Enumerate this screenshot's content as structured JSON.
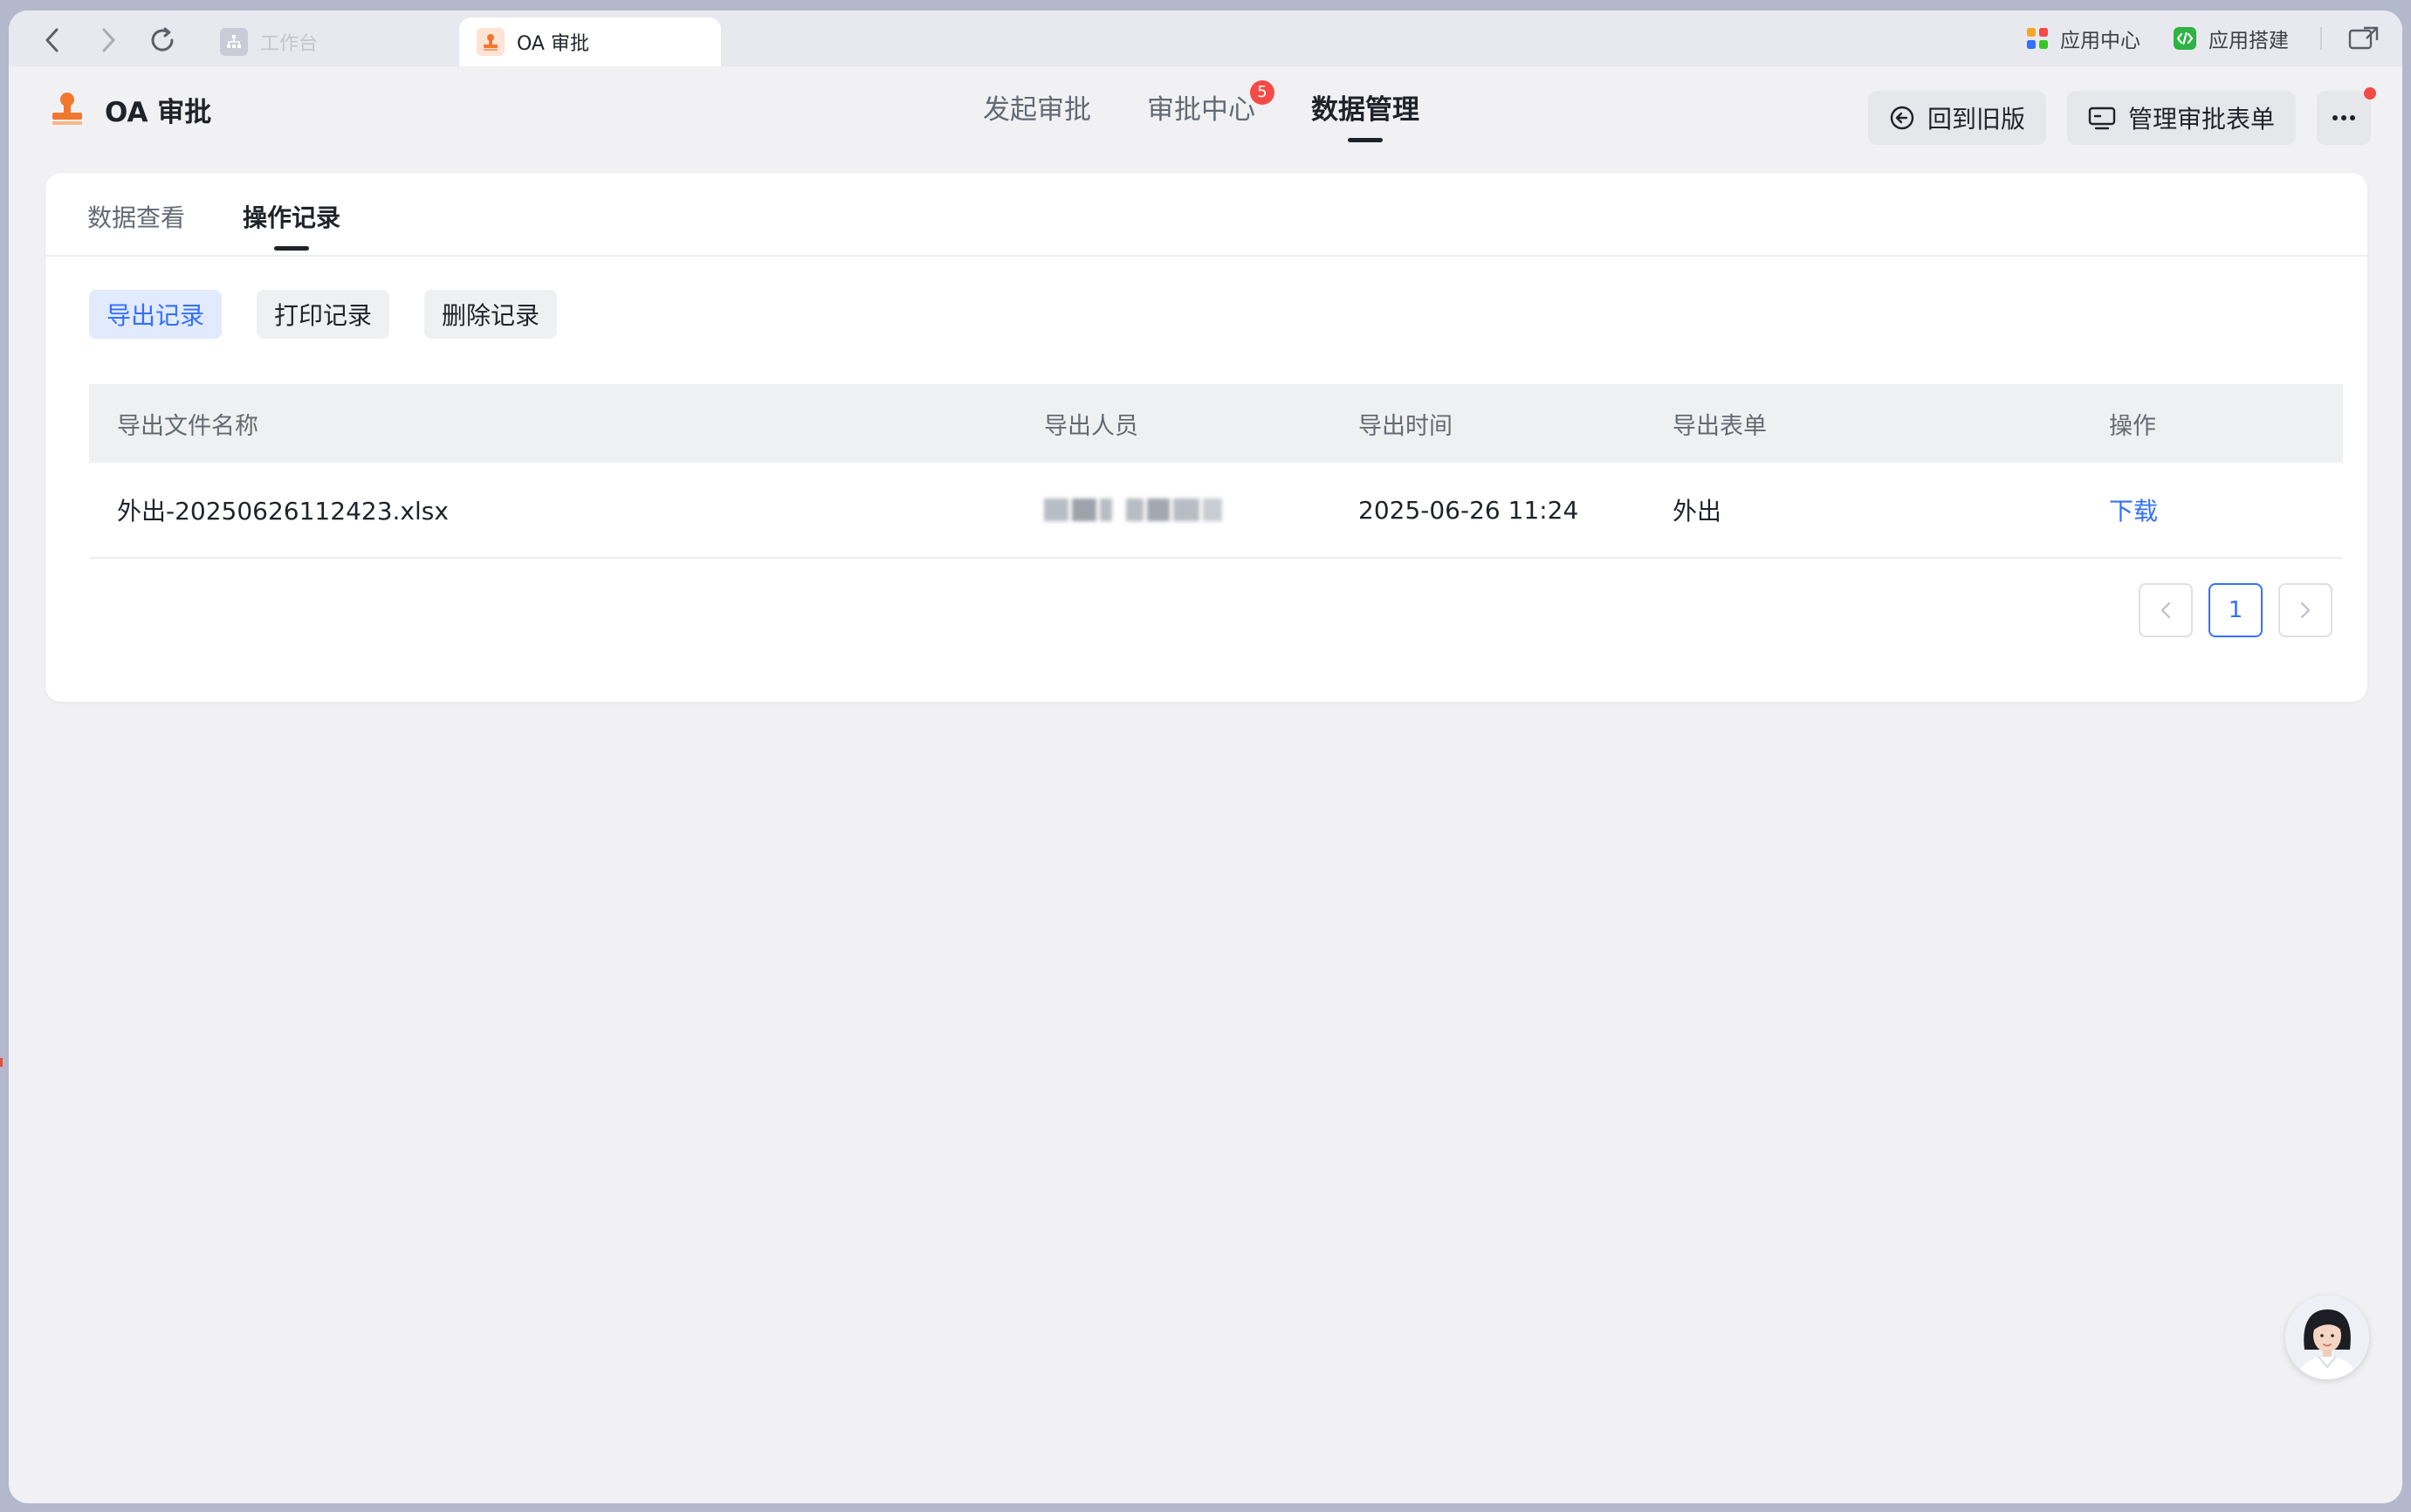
{
  "browser": {
    "tabs": [
      {
        "label": "工作台",
        "active": false
      },
      {
        "label": "OA 审批",
        "active": true
      }
    ],
    "right_links": [
      {
        "label": "应用中心",
        "icon": "app-center-icon"
      },
      {
        "label": "应用搭建",
        "icon": "app-builder-icon"
      }
    ]
  },
  "app": {
    "title": "OA 审批",
    "main_tabs": [
      {
        "label": "发起审批"
      },
      {
        "label": "审批中心",
        "badge": "5"
      },
      {
        "label": "数据管理"
      }
    ],
    "actions": {
      "back_to_old": "回到旧版",
      "manage_forms": "管理审批表单"
    }
  },
  "card": {
    "sub_tabs": [
      "数据查看",
      "操作记录"
    ],
    "filters": [
      "导出记录",
      "打印记录",
      "删除记录"
    ],
    "table": {
      "headers": [
        "导出文件名称",
        "导出人员",
        "导出时间",
        "导出表单",
        "操作"
      ],
      "rows": [
        {
          "file_name": "外出-20250626112423.xlsx",
          "time": "2025-06-26 11:24",
          "form": "外出",
          "action": "下载"
        }
      ]
    },
    "pagination": {
      "current": "1"
    }
  },
  "colors": {
    "accent": "#3370ff",
    "badge": "#f54a45",
    "window_bg": "#f1f1f4"
  }
}
